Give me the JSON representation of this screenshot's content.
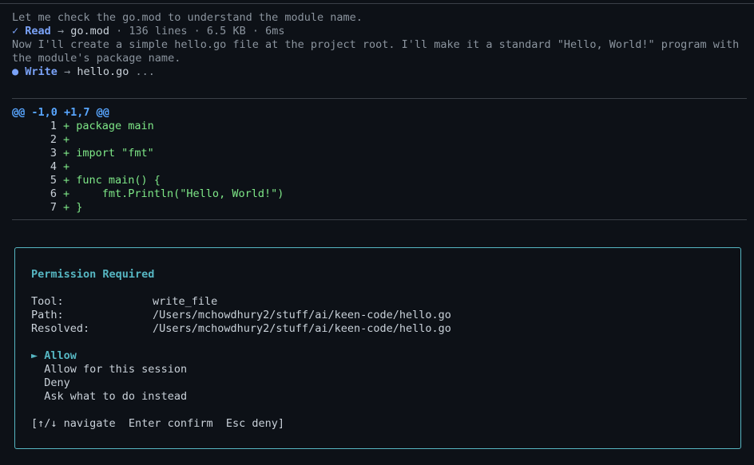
{
  "log": {
    "thought1": "Let me check the go.mod to understand the module name.",
    "read": {
      "status_icon": "✓",
      "tool": "Read",
      "arrow": "→",
      "target": "go.mod",
      "meta": "· 136 lines · 6.5 KB · 6ms"
    },
    "thought2": "Now I'll create a simple hello.go file at the project root. I'll make it a standard \"Hello, World!\" program with the module's package name.",
    "write": {
      "status_icon": "●",
      "tool": "Write",
      "arrow": "→",
      "target": "hello.go",
      "ellipsis": "..."
    }
  },
  "diff": {
    "hunk": "@@ -1,0 +1,7 @@",
    "lines": [
      {
        "num": "1",
        "text": "+ package main"
      },
      {
        "num": "2",
        "text": "+"
      },
      {
        "num": "3",
        "text": "+ import \"fmt\""
      },
      {
        "num": "4",
        "text": "+"
      },
      {
        "num": "5",
        "text": "+ func main() {"
      },
      {
        "num": "6",
        "text": "+     fmt.Println(\"Hello, World!\")"
      },
      {
        "num": "7",
        "text": "+ }"
      }
    ]
  },
  "permission": {
    "title": "Permission Required",
    "fields": [
      {
        "label": "Tool:",
        "value": "write_file"
      },
      {
        "label": "Path:",
        "value": "/Users/mchowdhury2/stuff/ai/keen-code/hello.go"
      },
      {
        "label": "Resolved:",
        "value": "/Users/mchowdhury2/stuff/ai/keen-code/hello.go"
      }
    ],
    "selected_marker": "►",
    "options": [
      "Allow",
      "Allow for this session",
      "Deny",
      "Ask what to do instead"
    ],
    "hint": "[↑/↓ navigate  Enter confirm  Esc deny]"
  },
  "colors": {
    "accent": "#56b6c2",
    "tool": "#7aa2f7",
    "added": "#7ee787",
    "background": "#0d1117"
  }
}
